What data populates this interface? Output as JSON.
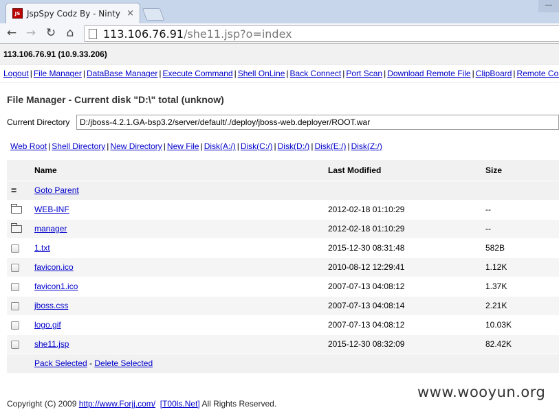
{
  "browser": {
    "tab_title": "JspSpy Codz By - Ninty",
    "tab_close": "×",
    "url_host": "113.106.76.91",
    "url_path": "/she11.jsp?o=index"
  },
  "ipbar": {
    "text": "113.106.76.91 (10.9.33.206)"
  },
  "navlinks": [
    "Logout",
    "File Manager",
    "DataBase Manager",
    "Execute Command",
    "Shell OnLine",
    "Back Connect",
    "Port Scan",
    "Download Remote File",
    "ClipBoard",
    "Remote Control"
  ],
  "heading": "File Manager - Current disk \"D:\\\" total (unknow)",
  "current_directory": {
    "label": "Current Directory",
    "value": "D:/jboss-4.2.1.GA-bsp3.2/server/default/./deploy/jboss-web.deployer/ROOT.war"
  },
  "quicklinks": [
    "Web Root",
    "Shell Directory",
    "New Directory",
    "New File",
    "Disk(A:/)",
    "Disk(C:/)",
    "Disk(D:/)",
    "Disk(E:/)",
    "Disk(Z:/)"
  ],
  "table": {
    "headers": {
      "name": "Name",
      "modified": "Last Modified",
      "size": "Size"
    },
    "parent": {
      "icon": "=",
      "label": "Goto Parent"
    },
    "rows": [
      {
        "type": "folder",
        "name": "WEB-INF",
        "modified": "2012-02-18 01:10:29",
        "size": "--"
      },
      {
        "type": "folder",
        "name": "manager",
        "modified": "2012-02-18 01:10:29",
        "size": "--"
      },
      {
        "type": "file",
        "name": "1.txt",
        "modified": "2015-12-30 08:31:48",
        "size": "582B"
      },
      {
        "type": "file",
        "name": "favicon.ico",
        "modified": "2010-08-12 12:29:41",
        "size": "1.12K"
      },
      {
        "type": "file",
        "name": "favicon1.ico",
        "modified": "2007-07-13 04:08:12",
        "size": "1.37K"
      },
      {
        "type": "file",
        "name": "jboss.css",
        "modified": "2007-07-13 04:08:14",
        "size": "2.21K"
      },
      {
        "type": "file",
        "name": "logo.gif",
        "modified": "2007-07-13 04:08:12",
        "size": "10.03K"
      },
      {
        "type": "file",
        "name": "she11.jsp",
        "modified": "2015-12-30 08:32:09",
        "size": "82.42K"
      }
    ],
    "actions": {
      "pack": "Pack Selected",
      "sep": " - ",
      "delete": "Delete Selected"
    }
  },
  "footer": {
    "prefix": "Copyright (C) 2009 ",
    "link1": "http://www.Forjj.com/",
    "link2": "[T00ls.Net]",
    "suffix": " All Rights Reserved."
  },
  "watermark": "www.wooyun.org",
  "icons": [
    "back-arrow-icon",
    "forward-arrow-icon",
    "reload-icon",
    "home-icon",
    "page-icon",
    "folder-icon",
    "checkbox-icon"
  ]
}
